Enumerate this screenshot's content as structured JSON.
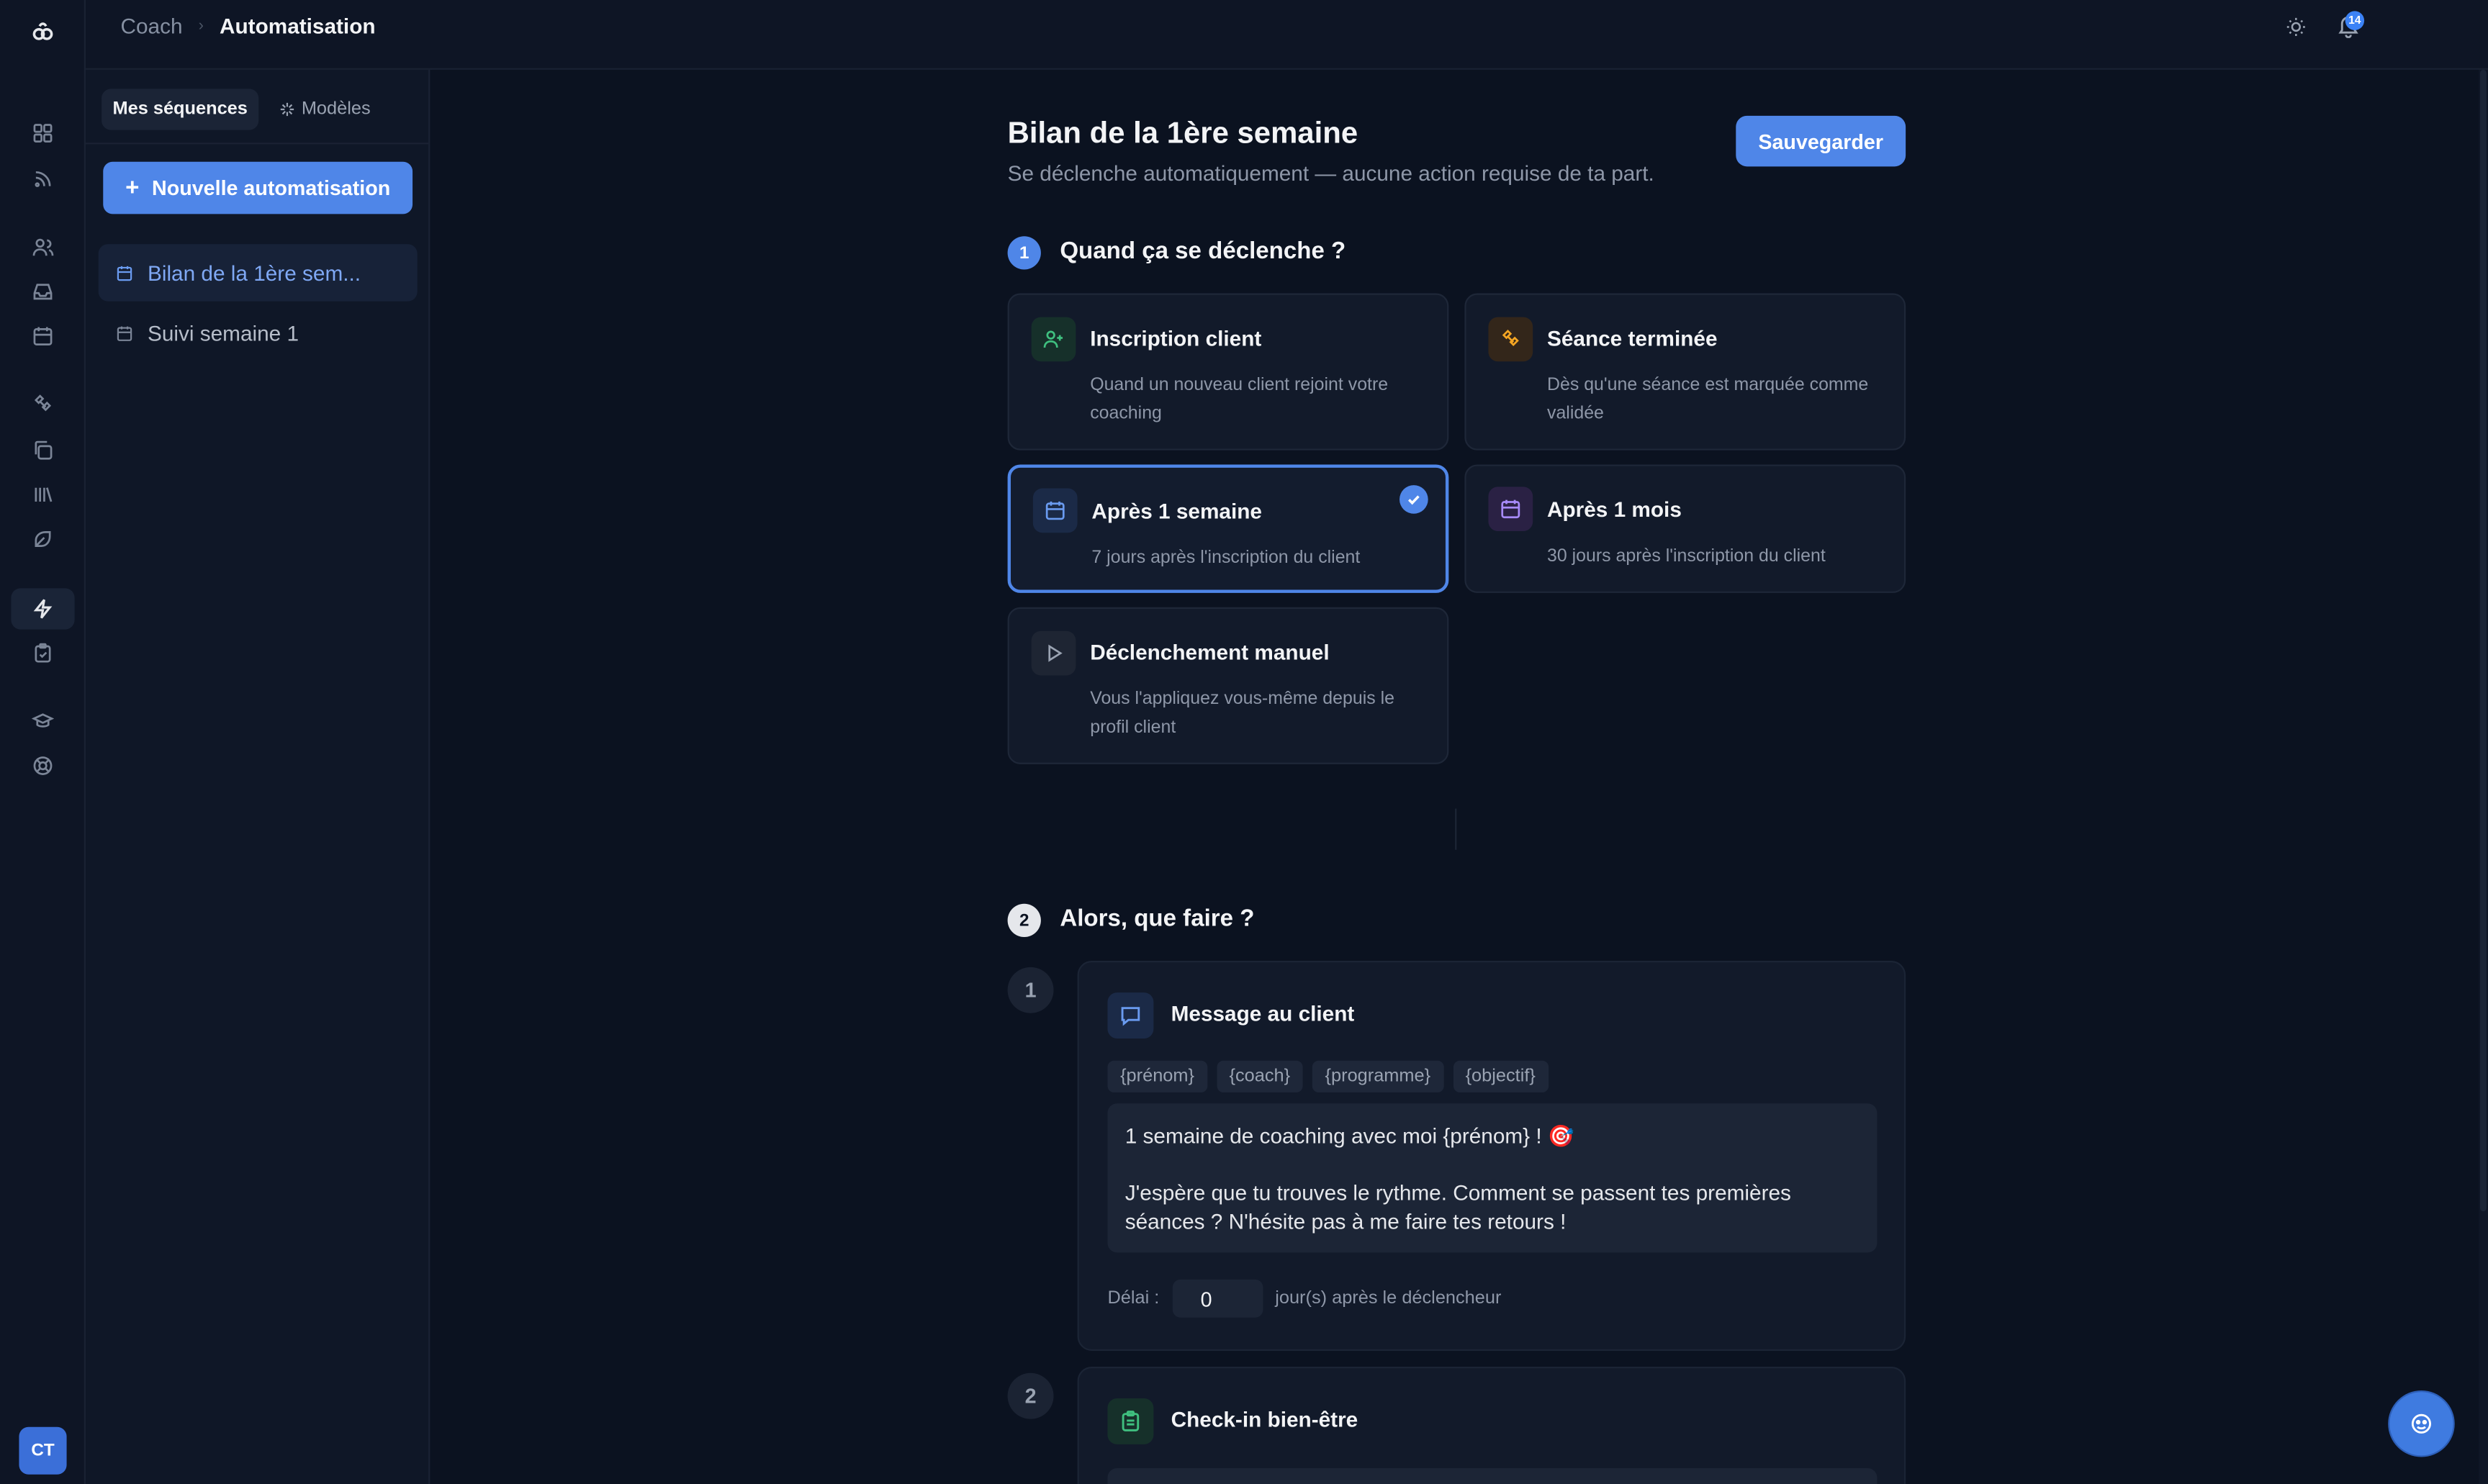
{
  "rail": {
    "avatar_initials": "CT",
    "icons": [
      "logo-icon",
      "dashboard-icon",
      "feed-icon",
      "users-icon",
      "inbox-icon",
      "calendar-icon",
      "exercises-icon",
      "copy-icon",
      "library-icon",
      "nutrition-icon",
      "automation-icon",
      "checklist-icon",
      "academy-icon",
      "support-icon"
    ]
  },
  "topbar": {
    "breadcrumb_parent": "Coach",
    "breadcrumb_current": "Automatisation",
    "notification_count": "14"
  },
  "sidebar": {
    "tabs": [
      {
        "label": "Mes séquences",
        "active": true
      },
      {
        "label": "Modèles",
        "active": false
      }
    ],
    "new_button": "Nouvelle automatisation",
    "sequences": [
      {
        "label": "Bilan de la 1ère sem...",
        "active": true
      },
      {
        "label": "Suivi semaine 1",
        "active": false
      }
    ]
  },
  "main": {
    "title": "Bilan de la 1ère semaine",
    "subtitle": "Se déclenche automatiquement — aucune action requise de ta part.",
    "save_button": "Sauvegarder",
    "step1": {
      "number": "1",
      "title": "Quand ça se déclenche ?",
      "triggers": [
        {
          "title": "Inscription client",
          "desc": "Quand un nouveau client rejoint votre coaching",
          "icon": "user-plus-icon",
          "color": "#3fbf7f",
          "selected": false
        },
        {
          "title": "Séance terminée",
          "desc": "Dès qu'une séance est marquée comme validée",
          "icon": "dumbbell-icon",
          "color": "#f5a623",
          "selected": false
        },
        {
          "title": "Après 1 semaine",
          "desc": "7 jours après l'inscription du client",
          "icon": "calendar-icon",
          "color": "#6a9bf0",
          "selected": true
        },
        {
          "title": "Après 1 mois",
          "desc": "30 jours après l'inscription du client",
          "icon": "calendar-icon",
          "color": "#a78bfa",
          "selected": false
        },
        {
          "title": "Déclenchement manuel",
          "desc": "Vous l'appliquez vous-même depuis le profil client",
          "icon": "play-icon",
          "color": "#9aa3b2",
          "selected": false
        }
      ]
    },
    "step2": {
      "number": "2",
      "title": "Alors, que faire ?",
      "actions": [
        {
          "number": "1",
          "title": "Message au client",
          "variables": [
            "{prénom}",
            "{coach}",
            "{programme}",
            "{objectif}"
          ],
          "message_line1": "1 semaine de coaching avec moi {prénom} ! 🎯",
          "message_line2": "J'espère que tu trouves le rythme. Comment se passent tes premières séances ? N'hésite pas à me faire tes retours !",
          "delay_label": "Délai :",
          "delay_value": "0",
          "delay_suffix": "jour(s) après le déclencheur"
        },
        {
          "number": "2",
          "title": "Check-in bien-être"
        }
      ]
    }
  }
}
